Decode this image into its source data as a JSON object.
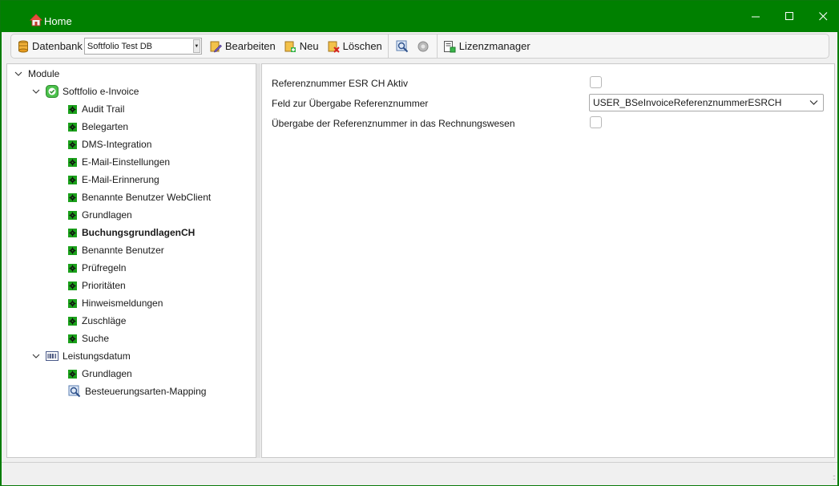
{
  "window": {
    "title": "Home",
    "minimize_glyph": "–",
    "maximize_glyph": "☐",
    "close_glyph": "✕"
  },
  "toolbar": {
    "database_label": "Datenbank",
    "database_value": "Softfolio Test DB",
    "edit_label": "Bearbeiten",
    "new_label": "Neu",
    "delete_label": "Löschen",
    "license_label": "Lizenzmanager"
  },
  "tree": {
    "root_label": "Module",
    "group1": {
      "label": "Softfolio e-Invoice",
      "items": [
        "Audit Trail",
        "Belegarten",
        "DMS-Integration",
        "E-Mail-Einstellungen",
        "E-Mail-Erinnerung",
        "Benannte Benutzer WebClient",
        "Grundlagen",
        "BuchungsgrundlagenCH",
        "Benannte Benutzer",
        "Prüfregeln",
        "Prioritäten",
        "Hinweismeldungen",
        "Zuschläge",
        "Suche"
      ],
      "selected_index": 7
    },
    "group2": {
      "label": "Leistungsdatum",
      "items": [
        "Grundlagen",
        "Besteuerungsarten-Mapping"
      ]
    }
  },
  "properties": {
    "row1_label": "Referenznummer ESR CH Aktiv",
    "row1_checked": false,
    "row2_label": "Feld zur Übergabe Referenznummer",
    "row2_value": "USER_BSeInvoiceReferenznummerESRCH",
    "row3_label": "Übergabe der Referenznummer in das Rechnungswesen",
    "row3_checked": false
  },
  "colors": {
    "titlebar": "#008000",
    "node_green": "#1aa01a"
  }
}
